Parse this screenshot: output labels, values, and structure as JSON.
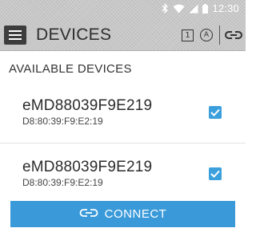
{
  "status_bar": {
    "time": "12:30",
    "icons": [
      "bluetooth-icon",
      "wifi-icon",
      "signal-icon",
      "battery-icon"
    ]
  },
  "toolbar": {
    "menu_icon": "hamburger-menu-icon",
    "title": "DEVICES",
    "action_box_label": "1",
    "action_circle_label": "A",
    "link_icon": "link-icon"
  },
  "section": {
    "title": "AVAILABLE DEVICES"
  },
  "devices": [
    {
      "name": "eMD88039F9E219",
      "mac": "D8:80:39:F9:E2:19",
      "checked": true
    },
    {
      "name": "eMD88039F9E219",
      "mac": "D8:80:39:F9:E2:19",
      "checked": true
    }
  ],
  "connect_button": {
    "label": "CONNECT",
    "icon": "link-icon"
  },
  "colors": {
    "accent": "#3a9ad9",
    "header_bg": "#c8c8c8"
  }
}
